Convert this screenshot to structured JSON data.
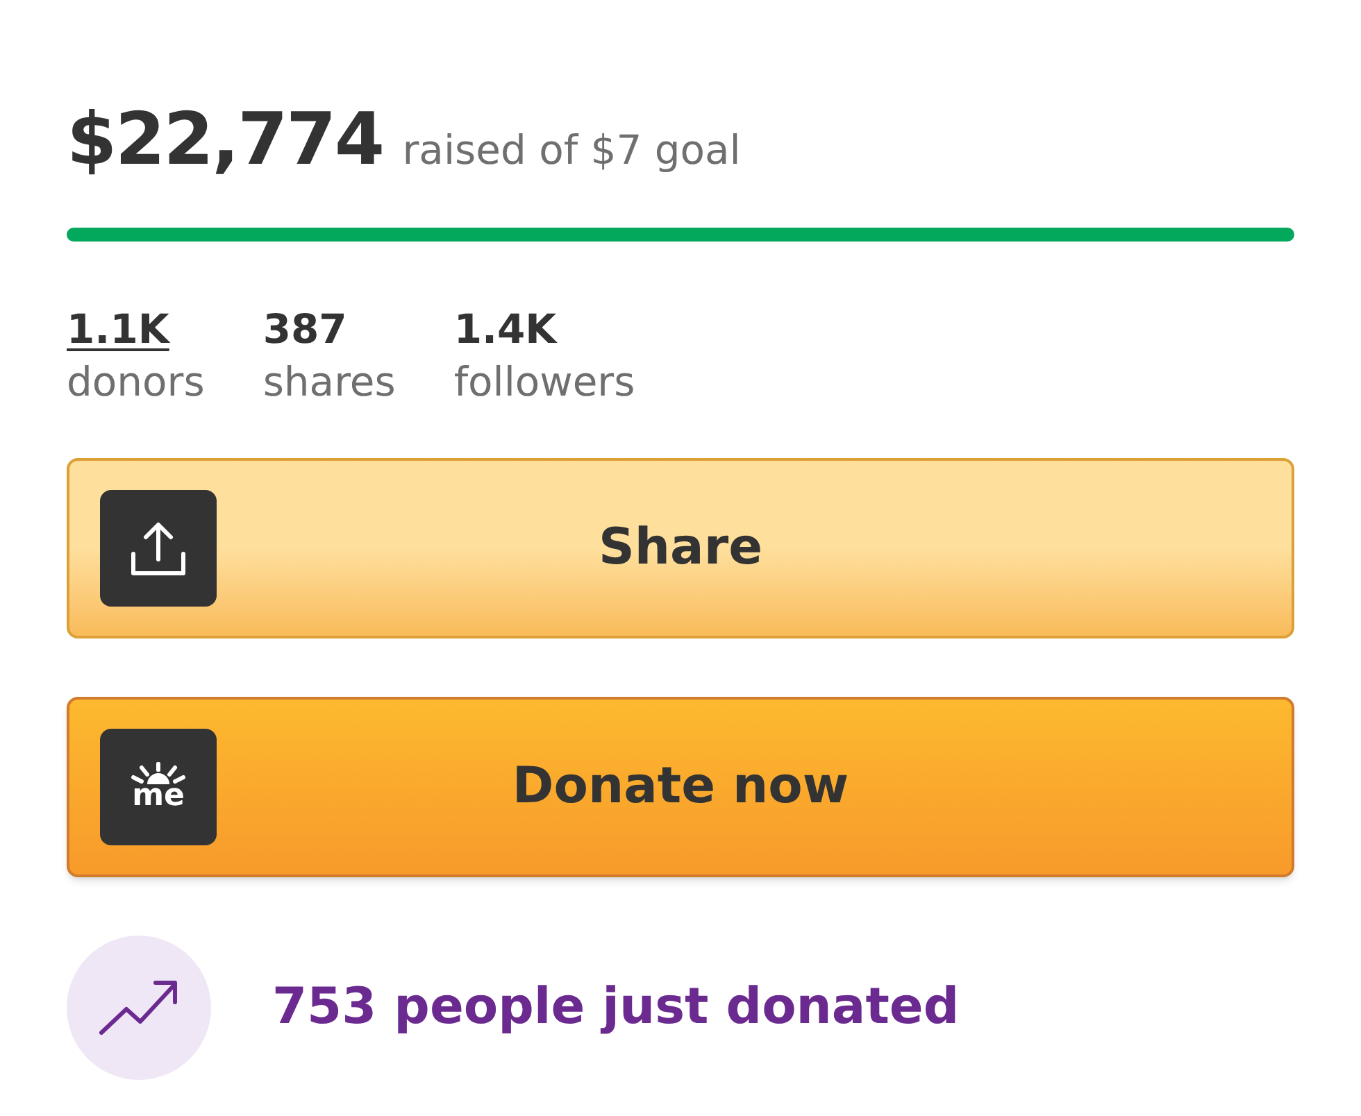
{
  "amount": {
    "raised": "$22,774",
    "goal_text": "raised of $7 goal"
  },
  "progress": {
    "level": 1
  },
  "stats": [
    {
      "value": "1.1K",
      "label": "donors",
      "link": true
    },
    {
      "value": "387",
      "label": "shares",
      "link": false
    },
    {
      "value": "1.4K",
      "label": "followers",
      "link": false
    }
  ],
  "buttons": [
    {
      "kind": "share",
      "label": "Share"
    },
    {
      "kind": "donate",
      "label": "Donate now",
      "icon_text": "me"
    }
  ],
  "activity": {
    "text": "753 people just donated"
  }
}
